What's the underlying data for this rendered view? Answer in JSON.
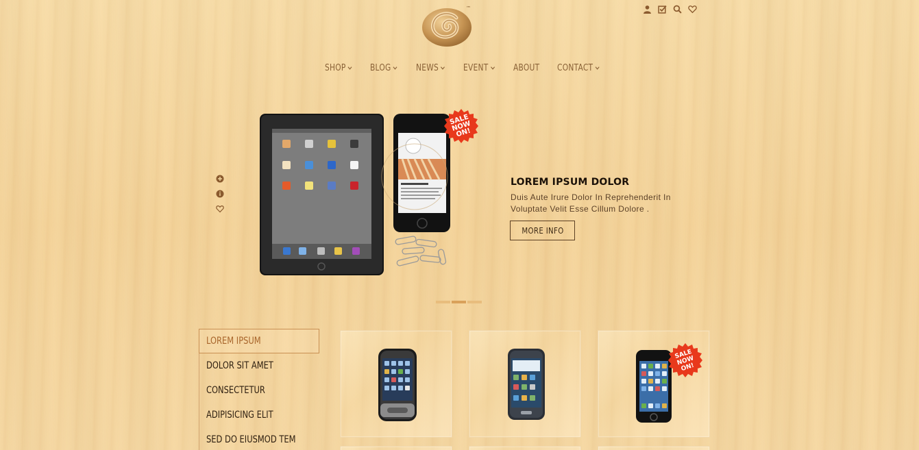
{
  "brand": {
    "trademark": "™"
  },
  "header": {
    "util_icons": [
      "user-icon",
      "checklist-icon",
      "search-icon",
      "heart-icon"
    ]
  },
  "nav": {
    "items": [
      {
        "label": "SHOP",
        "dropdown": true
      },
      {
        "label": "BLOG",
        "dropdown": true
      },
      {
        "label": "NEWS",
        "dropdown": true
      },
      {
        "label": "EVENT",
        "dropdown": true
      },
      {
        "label": "ABOUT",
        "dropdown": false
      },
      {
        "label": "CONTACT",
        "dropdown": true
      }
    ]
  },
  "slider": {
    "badge": "SALE NOW ON!",
    "side_icons": [
      "plus-circle-icon",
      "info-circle-icon",
      "heart-icon"
    ],
    "caption": {
      "title": "LOREM IPSUM DOLOR",
      "text": "Duis Aute Irure Dolor In Reprehenderit In Voluptate Velit Esse Cillum Dolore .",
      "button": "MORE INFO"
    },
    "dots": 3,
    "active_dot": 1
  },
  "categories": {
    "items": [
      "LOREM IPSUM",
      "DOLOR SIT AMET",
      "CONSECTETUR",
      "ADIPISICING ELIT",
      "SED DO EIUSMOD TEM"
    ],
    "active": 0
  },
  "products": {
    "cards": [
      {
        "image": "touchscreen-phone",
        "badge": ""
      },
      {
        "image": "galaxy-phone",
        "badge": ""
      },
      {
        "image": "iphone",
        "badge": "SALE NOW ON!"
      }
    ]
  },
  "colors": {
    "wood": "#f5d7a0",
    "nav_text": "#8a6237",
    "accent": "#a8652b",
    "sale_badge": "#e8391c"
  }
}
